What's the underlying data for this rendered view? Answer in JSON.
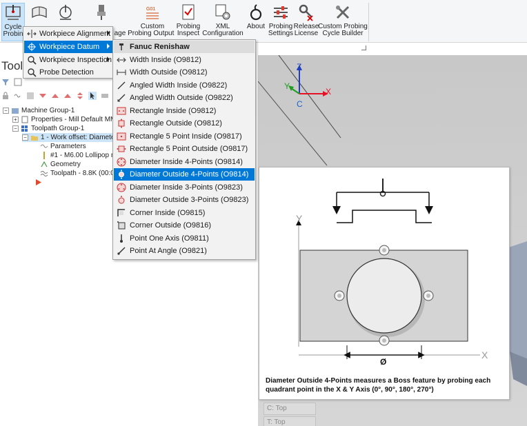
{
  "ribbon": {
    "buttons": [
      {
        "label": "Cycle\nProbin",
        "icon": "cycle-probing-icon"
      },
      {
        "label": "",
        "icon": "workpiece-icon"
      },
      {
        "label": "",
        "icon": "gauge-icon"
      },
      {
        "label": "",
        "icon": "probe-icon"
      },
      {
        "label": "age Probing Output",
        "icon": ""
      },
      {
        "label": "Custom",
        "icon": "g01-code-icon"
      },
      {
        "label": "Probing\nInspect",
        "icon": "inspect-report-icon"
      },
      {
        "label": "XML\nConfiguration",
        "icon": "xml-config-icon"
      },
      {
        "label": "About",
        "icon": "about-icon"
      },
      {
        "label": "Probing\nSettings",
        "icon": "settings-sliders-icon"
      },
      {
        "label": "Release\nLicense",
        "icon": "key-release-icon"
      },
      {
        "label": "Custom Probing\nCycle Builder",
        "icon": "tools-icon"
      }
    ]
  },
  "menu_level1": {
    "items": [
      {
        "label": "Workpiece Alignment",
        "icon": "alignment-icon"
      },
      {
        "label": "Workpiece Datum",
        "icon": "datum-crosshair-icon"
      },
      {
        "label": "Workpiece Inspection",
        "icon": "magnifier-icon"
      },
      {
        "label": "Probe Detection",
        "icon": "search-icon"
      }
    ]
  },
  "menu_level2": {
    "header": "Fanuc Renishaw",
    "items": [
      {
        "label": "Width Inside (O9812)",
        "icon": "width-inside-icon"
      },
      {
        "label": "Width Outside (O9812)",
        "icon": "width-outside-icon"
      },
      {
        "label": "Angled Width Inside (O9822)",
        "icon": "angled-width-inside-icon"
      },
      {
        "label": "Angled Width Outside (O9822)",
        "icon": "angled-width-outside-icon"
      },
      {
        "label": "Rectangle Inside (O9812)",
        "icon": "rectangle-inside-icon"
      },
      {
        "label": "Rectangle Outside (O9812)",
        "icon": "rectangle-outside-icon"
      },
      {
        "label": "Rectangle 5 Point Inside (O9817)",
        "icon": "rectangle-5pt-inside-icon"
      },
      {
        "label": "Rectangle 5 Point Outside (O9817)",
        "icon": "rectangle-5pt-outside-icon"
      },
      {
        "label": "Diameter Inside 4-Points (O9814)",
        "icon": "diameter-inside-4pt-icon"
      },
      {
        "label": "Diameter Outside 4-Points (O9814)",
        "icon": "diameter-outside-4pt-icon"
      },
      {
        "label": "Diameter Inside 3-Points (O9823)",
        "icon": "diameter-inside-3pt-icon"
      },
      {
        "label": "Diameter Outside 3-Points (O9823)",
        "icon": "diameter-outside-3pt-icon"
      },
      {
        "label": "Corner Inside (O9815)",
        "icon": "corner-inside-icon"
      },
      {
        "label": "Corner Outside (O9816)",
        "icon": "corner-outside-icon"
      },
      {
        "label": "Point One Axis (O9811)",
        "icon": "point-one-axis-icon"
      },
      {
        "label": "Point At Angle (O9821)",
        "icon": "point-at-angle-icon"
      }
    ]
  },
  "left_panel": {
    "title": "Toolp",
    "tree": [
      {
        "label": "Machine Group-1"
      },
      {
        "label": "Properties - Mill Default MM"
      },
      {
        "label": "Toolpath Group-1"
      },
      {
        "label": "1 - Work offset: Diamete"
      },
      {
        "label": "Parameters"
      },
      {
        "label": "#1 - M6.00 Lollipop m"
      },
      {
        "label": "Geometry"
      },
      {
        "label": "Toolpath - 8.8K (00:0"
      }
    ]
  },
  "viewport": {
    "axes": {
      "z": "Z",
      "y": "Y",
      "x": "X",
      "c": "C"
    },
    "view_fields": [
      "C: Top",
      "T: Top"
    ]
  },
  "help": {
    "diagram": {
      "y_label": "Y",
      "x_label": "X",
      "diameter_label": "Ø"
    },
    "description": "Diameter Outside 4-Points measures a Boss feature by probing each quadrant point in the X & Y Axis (0°, 90°, 180°, 270°)"
  },
  "colors": {
    "highlight": "#0078d7",
    "axis_x": "#e81123",
    "axis_y": "#1e9e1e",
    "axis_z": "#1f3fbf",
    "axis_c": "#2060d0"
  }
}
